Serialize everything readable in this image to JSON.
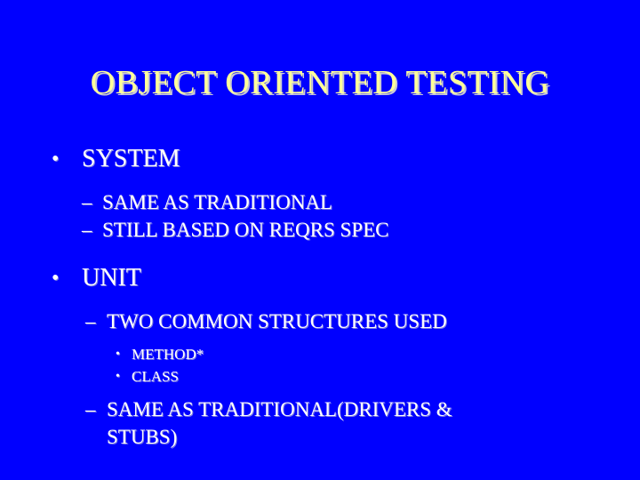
{
  "slide": {
    "background_color": "#0000FF",
    "title": {
      "text": "OBJECT ORIENTED TESTING",
      "color": "#FFFF99",
      "shadow_color": "#C9C9D4"
    },
    "body_color": "#FFFFFF",
    "markers": {
      "level1": "•",
      "level2": "–",
      "level3": "•"
    },
    "content": [
      {
        "level": 1,
        "marker": "•",
        "text": "SYSTEM"
      },
      {
        "level": 2,
        "marker": "–",
        "text": "SAME AS TRADITIONAL"
      },
      {
        "level": 2,
        "marker": "–",
        "text": "STILL BASED ON REQRS SPEC"
      },
      {
        "level": 1,
        "marker": "•",
        "text": "UNIT"
      },
      {
        "level": 2,
        "marker": "–",
        "text": "TWO COMMON STRUCTURES USED"
      },
      {
        "level": 3,
        "marker": "•",
        "text": "METHOD*"
      },
      {
        "level": 3,
        "marker": "•",
        "text": "CLASS"
      },
      {
        "level": 2,
        "marker": "–",
        "text_line1": "SAME AS TRADITIONAL(DRIVERS &",
        "text_line2": "STUBS)",
        "text": "SAME AS TRADITIONAL(DRIVERS & STUBS)"
      }
    ]
  }
}
